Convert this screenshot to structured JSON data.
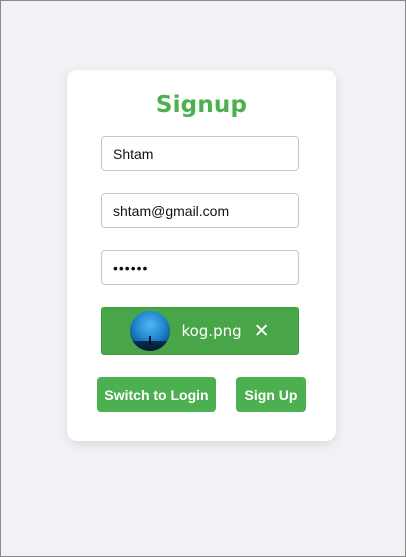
{
  "form": {
    "title": "Signup",
    "name_value": "Shtam",
    "email_value": "shtam@gmail.com",
    "password_value": "123456"
  },
  "upload": {
    "file_name": "kog.png",
    "remove_glyph": "✕",
    "thumbnail_icon": "image-thumbnail-icon",
    "remove_icon": "close-icon",
    "background_color": "#4caf50"
  },
  "actions": {
    "switch_label": "Switch to Login",
    "signup_label": "Sign Up"
  },
  "colors": {
    "accent": "#4caf50",
    "page_background": "#f0f2f5",
    "card_background": "#ffffff"
  }
}
